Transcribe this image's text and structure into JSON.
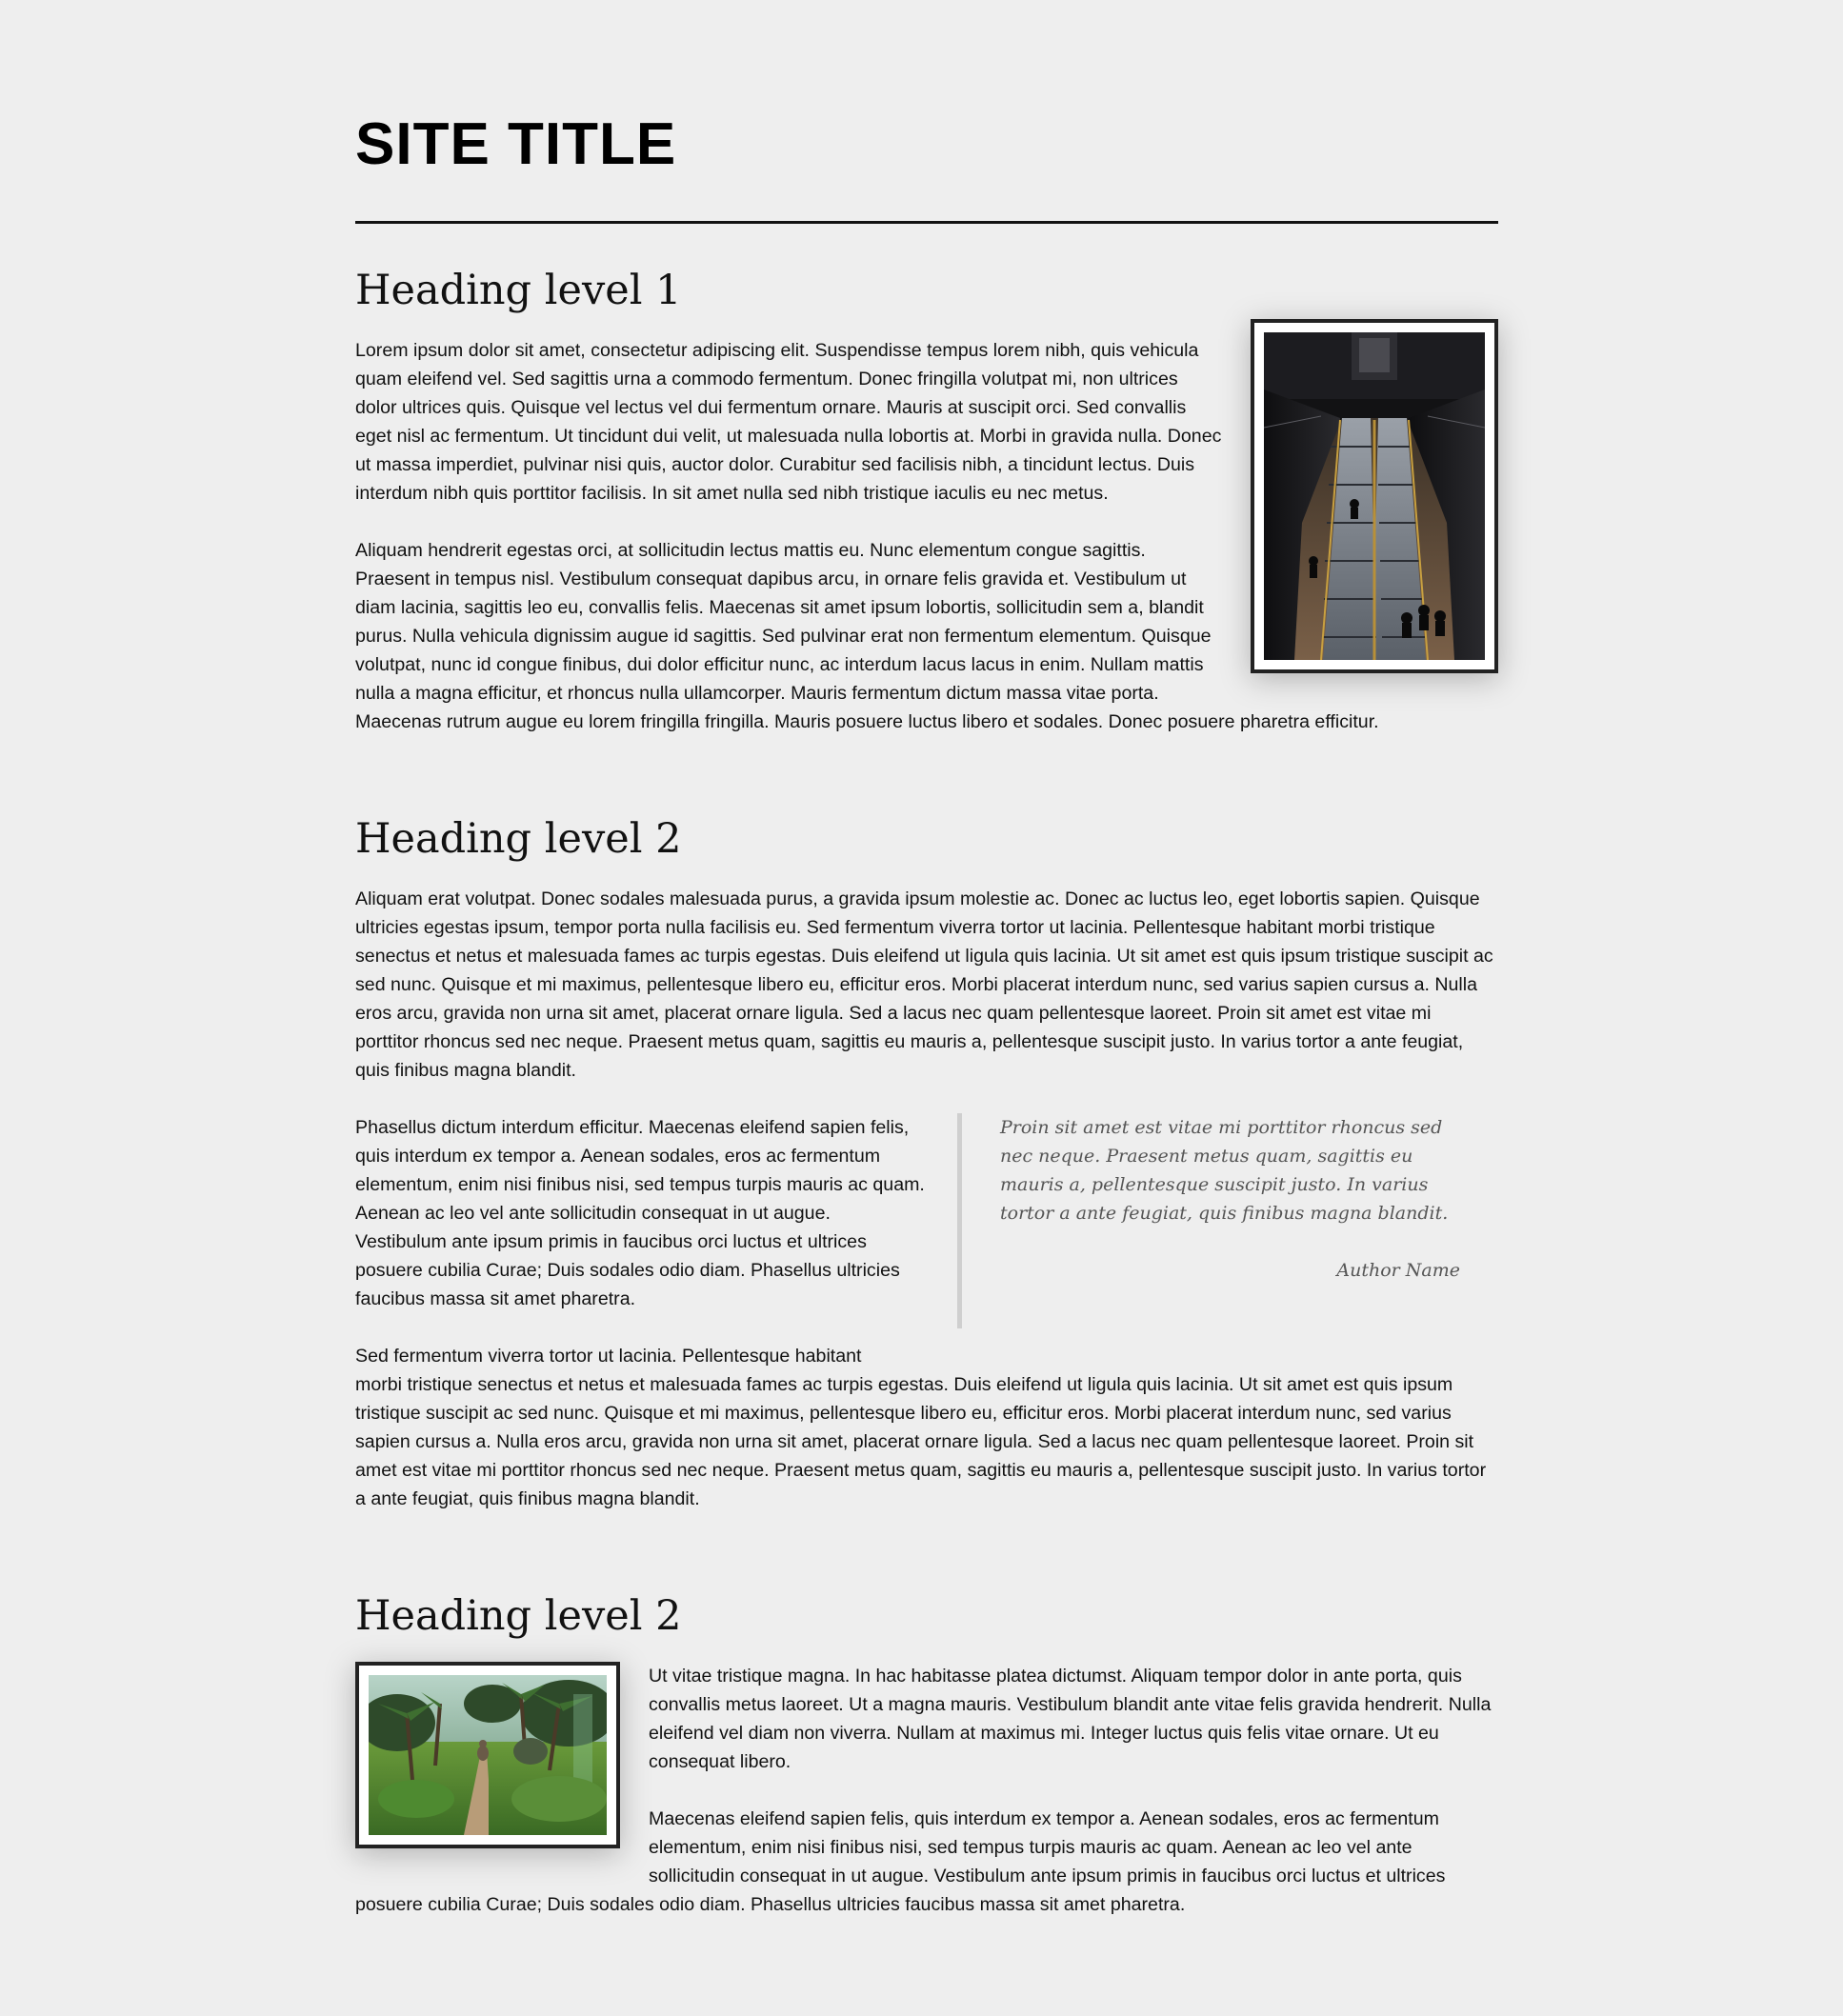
{
  "site": {
    "title": "SITE TITLE"
  },
  "section1": {
    "heading": "Heading level 1",
    "image_alt": "Aerial view of people on escalators in a dark subway station",
    "paragraphs": [
      "Lorem ipsum dolor sit amet, consectetur adipiscing elit. Suspendisse tempus lorem nibh, quis vehicula quam eleifend vel. Sed sagittis urna a commodo fermentum. Donec fringilla volutpat mi, non ultrices dolor ultrices quis. Quisque vel lectus vel dui fermentum ornare. Mauris at suscipit orci. Sed convallis eget nisl ac fermentum. Ut tincidunt dui velit, ut malesuada nulla lobortis at. Morbi in gravida nulla. Donec ut massa imperdiet, pulvinar nisi quis, auctor dolor. Curabitur sed facilisis nibh, a tincidunt lectus. Duis interdum nibh quis porttitor facilisis. In sit amet nulla sed nibh tristique iaculis eu nec metus.",
      "Aliquam hendrerit egestas orci, at sollicitudin lectus mattis eu. Nunc elementum congue sagittis. Praesent in tempus nisl. Vestibulum consequat dapibus arcu, in ornare felis gravida et. Vestibulum ut diam lacinia, sagittis leo eu, convallis felis. Maecenas sit amet ipsum lobortis, sollicitudin sem a, blandit purus. Nulla vehicula dignissim augue id sagittis. Sed pulvinar erat non fermentum elementum. Quisque volutpat, nunc id congue finibus, dui dolor efficitur nunc, ac interdum lacus lacus in enim. Nullam mattis nulla a magna efficitur, et rhoncus nulla ullamcorper. Mauris fermentum dictum massa vitae porta. Maecenas rutrum augue eu lorem fringilla fringilla. Mauris posuere luctus libero et sodales. Donec posuere pharetra efficitur."
    ]
  },
  "section2": {
    "heading": "Heading level 2",
    "intro": "Aliquam erat volutpat. Donec sodales malesuada purus, a gravida ipsum molestie ac. Donec ac luctus leo, eget lobortis sapien. Quisque ultricies egestas ipsum, tempor porta nulla facilisis eu. Sed fermentum viverra tortor ut lacinia. Pellentesque habitant morbi tristique senectus et netus et malesuada fames ac turpis egestas. Duis eleifend ut ligula quis lacinia. Ut sit amet est quis ipsum tristique suscipit ac sed nunc. Quisque et mi maximus, pellentesque libero eu, efficitur eros. Morbi placerat interdum nunc, sed varius sapien cursus a. Nulla eros arcu, gravida non urna sit amet, placerat ornare ligula. Sed a lacus nec quam pellentesque laoreet. Proin sit amet est vitae mi porttitor rhoncus sed nec neque. Praesent metus quam, sagittis eu mauris a, pellentesque suscipit justo. In varius tortor a ante feugiat, quis finibus magna blandit.",
    "column_text": "Phasellus dictum interdum efficitur. Maecenas eleifend sapien felis, quis interdum ex tempor a. Aenean sodales, eros ac fermentum elementum, enim nisi finibus nisi, sed tempus turpis mauris ac quam. Aenean ac leo vel ante sollicitudin consequat in ut augue. Vestibulum ante ipsum primis in faucibus orci luctus et ultrices posuere cubilia Curae; Duis sodales odio diam. Phasellus ultricies faucibus massa sit amet pharetra.",
    "column_text_2_start": "Sed fermentum viverra tortor ut lacinia. Pellentesque habitant",
    "quote": {
      "text": "Proin sit amet est vitae mi porttitor rhoncus sed nec neque. Praesent metus quam, sagittis eu mauris a, pellentesque suscipit justo. In varius tortor a ante feugiat, quis finibus magna blandit.",
      "author": "Author Name"
    },
    "outro": "morbi tristique senectus et netus et malesuada fames ac turpis egestas. Duis eleifend ut ligula quis lacinia. Ut sit amet est quis ipsum tristique suscipit ac sed nunc. Quisque et mi maximus, pellentesque libero eu, efficitur eros. Morbi placerat interdum nunc, sed varius sapien cursus a. Nulla eros arcu, gravida non urna sit amet, placerat ornare ligula. Sed a lacus nec quam pellentesque laoreet. Proin sit amet est vitae mi porttitor rhoncus sed nec neque. Praesent metus quam, sagittis eu mauris a, pellentesque suscipit justo. In varius tortor a ante feugiat, quis finibus magna blandit."
  },
  "section3": {
    "heading": "Heading level 2",
    "image_alt": "Jungle path with a dog walking among palm trees",
    "paragraphs": [
      "Ut vitae tristique magna. In hac habitasse platea dictumst. Aliquam tempor dolor in ante porta, quis convallis metus laoreet. Ut a magna mauris. Vestibulum blandit ante vitae felis gravida hendrerit. Nulla eleifend vel diam non viverra. Nullam at maximus mi. Integer luctus quis felis vitae ornare. Ut eu consequat libero.",
      "Maecenas eleifend sapien felis, quis interdum ex tempor a. Aenean sodales, eros ac fermentum elementum, enim nisi finibus nisi, sed tempus turpis mauris ac quam. Aenean ac leo vel ante sollicitudin consequat in ut augue. Vestibulum ante ipsum primis in faucibus orci luctus et ultrices posuere cubilia Curae; Duis sodales odio diam. Phasellus ultricies faucibus massa sit amet pharetra."
    ]
  }
}
